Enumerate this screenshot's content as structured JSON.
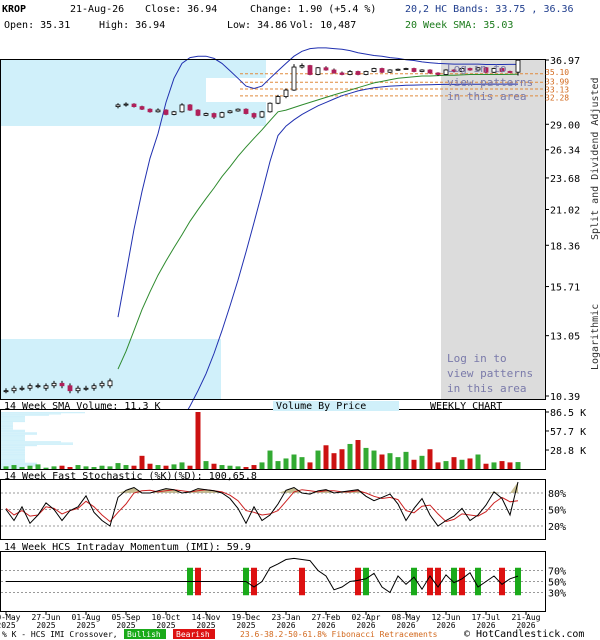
{
  "header": {
    "symbol": "KROP",
    "date": "21-Aug-26",
    "close": "Close: 36.94",
    "change": "Change: 1.90 (+5.4 %)",
    "bands": "20,2 HC Bands: 33.75 , 36.36",
    "open": "Open: 35.31",
    "high": "High: 36.94",
    "low": "Low: 34.86",
    "vol": "Vol: 10,487",
    "sma": "20 Week SMA: 35.03"
  },
  "price_axis": {
    "ticks": [
      "36.97",
      "29.00",
      "26.34",
      "23.68",
      "21.02",
      "18.36",
      "15.71",
      "13.05",
      "10.39"
    ],
    "fib_labels": [
      "35.10",
      "33.99",
      "33.13",
      "32.28"
    ],
    "side_label_top": "Split and Dividend Adjusted",
    "side_label_bottom": "Logarithmic"
  },
  "watermark": {
    "top": [
      "Log in to",
      "view patterns",
      "in this area"
    ],
    "bottom": [
      "Log in to",
      "view patterns",
      "in this area"
    ]
  },
  "volume_panel": {
    "title": "14 Week SMA Volume: 11.3 K",
    "vbp": "Volume By Price",
    "weekly": "WEEKLY CHART",
    "ticks": [
      "86.5 K",
      "57.7 K",
      "28.8 K"
    ]
  },
  "stoch_panel": {
    "title": "14 Week Fast Stochastic (%K)(%D): 100,65.8",
    "ticks": [
      "80%",
      "50%",
      "20%"
    ]
  },
  "imi_panel": {
    "title": "14 Week HCS Intraday Momentum (IMI): 59.9",
    "ticks": [
      "70%",
      "50%",
      "30%"
    ]
  },
  "x_axis": {
    "dates": [
      [
        "30-May",
        "2025"
      ],
      [
        "27-Jun",
        "2025"
      ],
      [
        "01-Aug",
        "2025"
      ],
      [
        "05-Sep",
        "2025"
      ],
      [
        "10-Oct",
        "2025"
      ],
      [
        "14-Nov",
        "2025"
      ],
      [
        "19-Dec",
        "2025"
      ],
      [
        "23-Jan",
        "2026"
      ],
      [
        "27-Feb",
        "2026"
      ],
      [
        "02-Apr",
        "2026"
      ],
      [
        "08-May",
        "2026"
      ],
      [
        "12-Jun",
        "2026"
      ],
      [
        "17-Jul",
        "2026"
      ],
      [
        "21-Aug",
        "2026"
      ]
    ]
  },
  "footer": {
    "legend": "% K - HCS IMI Crossover,",
    "bullish": "Bullish",
    "bearish": "Bearish",
    "fib": "23.6-38.2-50-61.8% Fibonacci Retracements",
    "copyright": "© HotCandlestick.com"
  },
  "colors": {
    "up": "#ffffff",
    "down": "#b0205a",
    "sma": "#2e8b2e",
    "bands": "#2030b0",
    "vol_up": "#33aa33",
    "vol_down": "#cc1111",
    "shade": "#d0f0fa",
    "bullish": "#1aaa1a",
    "bearish": "#dd1111"
  },
  "chart_data": {
    "type": "candlestick",
    "title": "KROP",
    "y_scale": "log",
    "ylim": [
      10.39,
      36.97
    ],
    "x": [
      "2025-05-30",
      "2025-06-06",
      "2025-06-13",
      "2025-06-20",
      "2025-06-27",
      "2025-07-04",
      "2025-07-11",
      "2025-07-18",
      "2025-07-25",
      "2025-08-01",
      "2025-08-08",
      "2025-08-15",
      "2025-08-22",
      "2025-08-29",
      "2025-09-05",
      "2025-09-12",
      "2025-09-19",
      "2025-09-26",
      "2025-10-03",
      "2025-10-10",
      "2025-10-17",
      "2025-10-24",
      "2025-10-31",
      "2025-11-07",
      "2025-11-14",
      "2025-11-21",
      "2025-11-28",
      "2025-12-05",
      "2025-12-12",
      "2025-12-19",
      "2025-12-26",
      "2026-01-02",
      "2026-01-09",
      "2026-01-16",
      "2026-01-23",
      "2026-01-30",
      "2026-02-06",
      "2026-02-13",
      "2026-02-20",
      "2026-02-27",
      "2026-03-06",
      "2026-03-13",
      "2026-03-20",
      "2026-03-27",
      "2026-04-02",
      "2026-04-10",
      "2026-04-17",
      "2026-04-24",
      "2026-05-01",
      "2026-05-08",
      "2026-05-15",
      "2026-05-22",
      "2026-05-29",
      "2026-06-05",
      "2026-06-12",
      "2026-06-19",
      "2026-06-26",
      "2026-07-03",
      "2026-07-10",
      "2026-07-17",
      "2026-07-24",
      "2026-07-31",
      "2026-08-07",
      "2026-08-14",
      "2026-08-21"
    ],
    "open": [
      10.6,
      10.6,
      10.7,
      10.7,
      10.8,
      10.7,
      10.8,
      10.9,
      10.8,
      10.6,
      10.7,
      10.7,
      10.8,
      10.8,
      31.0,
      31.2,
      31.3,
      31.0,
      30.7,
      30.4,
      30.6,
      30.1,
      30.4,
      31.2,
      30.6,
      30.0,
      30.2,
      29.8,
      30.3,
      30.5,
      30.7,
      30.2,
      29.8,
      30.4,
      31.4,
      32.2,
      33.0,
      36.0,
      36.2,
      35.0,
      35.9,
      35.6,
      35.2,
      35.0,
      35.4,
      35.0,
      35.4,
      35.8,
      35.3,
      35.6,
      35.7,
      35.8,
      35.4,
      35.6,
      35.2,
      35.0,
      35.6,
      35.4,
      35.8,
      35.6,
      35.9,
      35.3,
      35.8,
      35.4,
      35.31
    ],
    "close": [
      10.6,
      10.7,
      10.7,
      10.8,
      10.8,
      10.8,
      10.9,
      10.8,
      10.6,
      10.7,
      10.7,
      10.8,
      10.9,
      11.0,
      31.2,
      31.3,
      31.0,
      30.7,
      30.4,
      30.6,
      30.1,
      30.4,
      31.2,
      30.6,
      30.0,
      30.2,
      29.8,
      30.3,
      30.5,
      30.7,
      30.2,
      29.8,
      30.4,
      31.4,
      32.2,
      33.0,
      36.0,
      36.2,
      35.0,
      35.9,
      35.6,
      35.2,
      35.0,
      35.4,
      35.0,
      35.4,
      35.8,
      35.3,
      35.6,
      35.7,
      35.8,
      35.4,
      35.6,
      35.2,
      35.0,
      35.6,
      35.4,
      35.8,
      35.6,
      35.9,
      35.3,
      35.8,
      35.4,
      35.31,
      36.94
    ],
    "high": [
      10.7,
      10.8,
      10.8,
      10.9,
      10.9,
      10.9,
      11.0,
      11.0,
      10.9,
      10.8,
      10.8,
      10.9,
      11.0,
      11.1,
      31.4,
      31.5,
      31.4,
      31.1,
      30.8,
      30.8,
      30.7,
      30.5,
      31.4,
      31.3,
      30.7,
      30.3,
      30.3,
      30.4,
      30.6,
      30.8,
      30.8,
      30.3,
      30.5,
      31.5,
      32.4,
      33.2,
      36.4,
      36.5,
      36.3,
      36.0,
      36.1,
      35.8,
      35.4,
      35.6,
      35.5,
      35.5,
      35.9,
      35.9,
      35.7,
      35.8,
      35.9,
      35.9,
      35.7,
      35.7,
      35.3,
      35.7,
      35.7,
      35.9,
      35.9,
      36.0,
      36.0,
      35.9,
      35.9,
      35.5,
      36.94
    ],
    "low": [
      10.5,
      10.5,
      10.6,
      10.6,
      10.7,
      10.6,
      10.7,
      10.7,
      10.5,
      10.5,
      10.6,
      10.6,
      10.7,
      10.7,
      30.8,
      31.0,
      30.9,
      30.6,
      30.3,
      30.3,
      30.0,
      30.0,
      30.3,
      30.5,
      29.9,
      29.9,
      29.6,
      29.7,
      30.2,
      30.4,
      30.1,
      29.6,
      29.7,
      30.3,
      31.3,
      32.0,
      32.9,
      35.8,
      34.9,
      34.9,
      35.5,
      35.1,
      34.9,
      34.9,
      34.9,
      34.9,
      35.3,
      35.2,
      35.2,
      35.5,
      35.6,
      35.3,
      35.3,
      35.1,
      34.8,
      34.9,
      35.3,
      35.3,
      35.5,
      35.5,
      35.2,
      35.2,
      35.3,
      35.2,
      34.86
    ],
    "sma20": [
      null,
      null,
      null,
      null,
      null,
      null,
      null,
      null,
      null,
      null,
      null,
      null,
      null,
      null,
      11.5,
      12.3,
      13.3,
      14.4,
      15.4,
      16.4,
      17.3,
      18.2,
      19.1,
      20.1,
      21.0,
      21.9,
      22.8,
      23.8,
      24.7,
      25.7,
      26.6,
      27.5,
      28.4,
      29.4,
      30.4,
      30.6,
      30.9,
      31.2,
      31.5,
      31.8,
      32.1,
      32.4,
      32.7,
      33.0,
      33.3,
      33.6,
      33.9,
      34.1,
      34.3,
      34.5,
      34.6,
      34.7,
      34.8,
      34.8,
      34.85,
      34.9,
      34.9,
      34.95,
      35.0,
      35.0,
      35.0,
      35.0,
      35.0,
      35.01,
      35.03
    ],
    "band_upper": [
      null,
      null,
      null,
      null,
      null,
      null,
      null,
      null,
      null,
      null,
      null,
      null,
      null,
      null,
      14.0,
      16.5,
      19.5,
      22.5,
      25.5,
      28.0,
      31.5,
      34.5,
      36.5,
      37.3,
      37.5,
      37.5,
      37.2,
      36.5,
      35.5,
      34.5,
      33.5,
      33.2,
      33.5,
      34.5,
      35.5,
      36.5,
      37.5,
      38.2,
      38.6,
      38.7,
      38.7,
      38.6,
      38.5,
      38.3,
      38.0,
      37.8,
      37.6,
      37.5,
      37.3,
      37.2,
      37.0,
      36.9,
      36.7,
      36.6,
      36.5,
      36.45,
      36.4,
      36.4,
      36.4,
      36.4,
      36.35,
      36.35,
      36.35,
      36.36,
      36.36
    ],
    "band_lower": [
      null,
      null,
      null,
      null,
      null,
      null,
      null,
      null,
      null,
      null,
      null,
      null,
      null,
      null,
      9.2,
      8.8,
      8.6,
      8.5,
      8.5,
      8.6,
      8.8,
      9.1,
      9.5,
      10.0,
      10.6,
      11.3,
      12.2,
      13.3,
      14.6,
      16.1,
      17.9,
      20.0,
      22.4,
      25.2,
      27.8,
      28.8,
      29.5,
      30.1,
      30.6,
      31.1,
      31.5,
      31.9,
      32.3,
      32.6,
      32.9,
      33.1,
      33.3,
      33.4,
      33.5,
      33.55,
      33.6,
      33.62,
      33.65,
      33.68,
      33.7,
      33.71,
      33.72,
      33.73,
      33.74,
      33.74,
      33.75,
      33.75,
      33.75,
      33.75,
      33.75
    ],
    "volume_k": [
      4,
      6,
      3,
      5,
      7,
      2,
      4,
      5,
      3,
      6,
      4,
      3,
      5,
      4,
      9,
      6,
      5,
      20,
      8,
      6,
      5,
      7,
      10,
      5,
      86.5,
      12,
      8,
      6,
      5,
      4,
      3,
      6,
      10,
      28,
      12,
      16,
      22,
      18,
      10,
      28,
      36,
      24,
      30,
      38,
      44,
      32,
      28,
      22,
      24,
      18,
      26,
      14,
      20,
      30,
      10,
      12,
      18,
      14,
      16,
      22,
      8,
      10,
      12,
      10,
      10.5
    ],
    "stoch_k": [
      50,
      30,
      55,
      25,
      40,
      62,
      50,
      30,
      48,
      55,
      75,
      45,
      30,
      20,
      72,
      85,
      90,
      80,
      80,
      84,
      88,
      86,
      80,
      82,
      88,
      86,
      84,
      80,
      70,
      52,
      25,
      55,
      30,
      40,
      60,
      85,
      90,
      80,
      78,
      84,
      86,
      80,
      82,
      84,
      86,
      74,
      66,
      72,
      78,
      60,
      30,
      52,
      70,
      40,
      20,
      30,
      38,
      52,
      30,
      40,
      58,
      82,
      70,
      40,
      100
    ],
    "stoch_d": [
      52,
      40,
      48,
      38,
      40,
      55,
      52,
      42,
      48,
      52,
      65,
      55,
      40,
      28,
      45,
      60,
      80,
      84,
      85,
      82,
      84,
      86,
      84,
      82,
      84,
      86,
      84,
      82,
      76,
      66,
      48,
      45,
      40,
      42,
      48,
      65,
      82,
      86,
      84,
      82,
      84,
      84,
      82,
      82,
      84,
      80,
      74,
      70,
      72,
      68,
      48,
      44,
      56,
      58,
      42,
      28,
      32,
      42,
      40,
      38,
      46,
      62,
      72,
      64,
      65.8
    ],
    "imi": [
      50,
      50,
      50,
      50,
      50,
      50,
      50,
      50,
      50,
      50,
      50,
      50,
      50,
      50,
      50,
      50,
      50,
      50,
      50,
      50,
      50,
      50,
      50,
      50,
      50,
      50,
      50,
      50,
      50,
      50,
      50,
      40,
      50,
      75,
      82,
      90,
      92,
      90,
      88,
      70,
      60,
      35,
      40,
      50,
      52,
      55,
      65,
      40,
      30,
      60,
      45,
      58,
      36,
      60,
      40,
      62,
      48,
      55,
      66,
      40,
      50,
      60,
      45,
      55,
      59.9
    ],
    "crossovers": [
      [
        23,
        "bullish"
      ],
      [
        24,
        "bearish"
      ],
      [
        30,
        "bullish"
      ],
      [
        31,
        "bearish"
      ],
      [
        37,
        "bearish"
      ],
      [
        44,
        "bearish"
      ],
      [
        45,
        "bullish"
      ],
      [
        51,
        "bullish"
      ],
      [
        53,
        "bearish"
      ],
      [
        54,
        "bearish"
      ],
      [
        56,
        "bullish"
      ],
      [
        57,
        "bearish"
      ],
      [
        59,
        "bullish"
      ],
      [
        62,
        "bearish"
      ],
      [
        64,
        "bullish"
      ]
    ],
    "vbp": [
      7,
      5,
      4,
      2,
      2,
      2,
      2,
      2,
      1,
      1,
      1,
      1,
      1,
      1,
      2,
      2,
      3,
      3,
      2,
      2,
      2,
      2,
      2,
      5,
      6,
      6,
      3,
      2,
      2,
      2,
      2,
      2,
      2,
      2,
      2,
      2,
      2,
      2,
      2,
      2,
      3,
      3,
      3,
      2,
      2
    ],
    "fib_retracements": [
      35.1,
      33.99,
      33.13,
      32.28
    ]
  }
}
